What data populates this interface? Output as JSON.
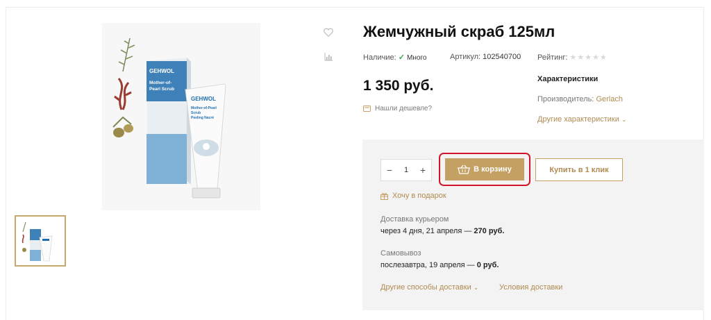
{
  "product": {
    "title": "Жемчужный скраб 125мл",
    "availability_label": "Наличие:",
    "availability_value": "Много",
    "article_label": "Артикул:",
    "article_value": "102540700",
    "rating_label": "Рейтинг:",
    "rating_stars": 5,
    "rating_value": 0,
    "price": "1 350 руб.",
    "cheaper_link": "Нашли дешевле?"
  },
  "package_art": {
    "brand": "GEHWOL",
    "box_line1": "Mother-of-",
    "box_line2": "Pearl Scrub",
    "tube_line1": "Mother-of-Pearl",
    "tube_line2": "Scrub",
    "tube_line3": "Peeling Nacré"
  },
  "characteristics": {
    "title": "Характеристики",
    "maker_label": "Производитель:",
    "maker_value": "Gerlach",
    "other_link": "Другие характеристики"
  },
  "buy": {
    "quantity": "1",
    "minus": "−",
    "plus": "+",
    "cart_button": "В корзину",
    "one_click_button": "Купить в 1 клик",
    "gift_link": "Хочу в подарок"
  },
  "delivery": {
    "courier_label": "Доставка курьером",
    "courier_text": "через 4 дня, 21 апреля —",
    "courier_price": "270 руб.",
    "pickup_label": "Самовывоз",
    "pickup_text": "послезавтра, 19 апреля —",
    "pickup_price": "0 руб.",
    "other_methods_link": "Другие способы доставки",
    "terms_link": "Условия доставки"
  },
  "colors": {
    "accent_gold": "#c5a063",
    "highlight_red": "#d4122a",
    "in_stock_green": "#3aa64a"
  },
  "icons": {
    "wishlist": "heart-icon",
    "compare": "bar-chart-icon",
    "cheaper": "price-tag-icon",
    "cart": "basket-icon",
    "gift": "gift-icon"
  }
}
